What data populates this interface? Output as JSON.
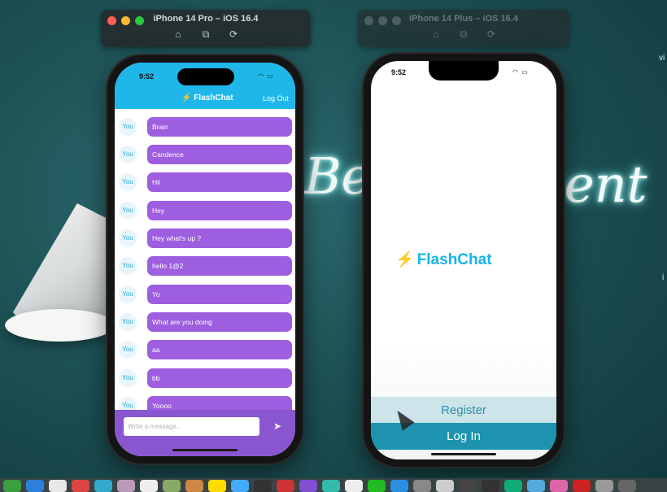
{
  "simulators": {
    "left_title": "iPhone 14 Pro – iOS 16.4",
    "right_title": "iPhone 14 Plus – iOS 16.4",
    "toolbar_icons": [
      "home-icon",
      "screenshot-icon",
      "rotate-icon"
    ],
    "window_dot_colors": [
      "#fe5f57",
      "#febc2e",
      "#28c840"
    ]
  },
  "background": {
    "neon_left": "Be",
    "neon_right": "ent",
    "edge_top": "vi",
    "edge_mid": "i"
  },
  "left_phone": {
    "status_time": "9:52",
    "app_icon": "bolt-icon",
    "brand": "FlashChat",
    "logout": "Log Out",
    "messages": [
      {
        "sender": "You",
        "text": "Brain"
      },
      {
        "sender": "You",
        "text": "Candence"
      },
      {
        "sender": "You",
        "text": "Hii"
      },
      {
        "sender": "You",
        "text": "Hey"
      },
      {
        "sender": "You",
        "text": "Hey what's up ?"
      },
      {
        "sender": "You",
        "text": "hello 1@2"
      },
      {
        "sender": "You",
        "text": "Yo"
      },
      {
        "sender": "You",
        "text": "What are you doing"
      },
      {
        "sender": "You",
        "text": "aa"
      },
      {
        "sender": "You",
        "text": "bb"
      },
      {
        "sender": "You",
        "text": "Yoooo"
      }
    ],
    "composer_placeholder": "Write a message...",
    "send_icon": "send-icon",
    "colors": {
      "header": "#1fb7ea",
      "bubble": "#9d5ee0",
      "composer": "#8a56cf"
    }
  },
  "right_phone": {
    "status_time": "9:52",
    "brand": "FlashChat",
    "register_label": "Register",
    "login_label": "Log In",
    "colors": {
      "brand": "#15b5ea",
      "register_bg": "#cce4ea",
      "login_bg": "#1d93b0"
    }
  },
  "dock": {
    "icon_colors": [
      "#3a9d3f",
      "#2d7fd8",
      "#e8e8e8",
      "#d44",
      "#3ac",
      "#b9b",
      "#eee",
      "#8a6",
      "#c84",
      "#fd0",
      "#4af",
      "#333",
      "#c33",
      "#8050d0",
      "#3ba",
      "#eee",
      "#2b2",
      "#2a8fe0",
      "#888",
      "#ccc",
      "#444",
      "#333",
      "#1a7",
      "#5ad",
      "#d6a",
      "#c22",
      "#999",
      "#666"
    ]
  }
}
